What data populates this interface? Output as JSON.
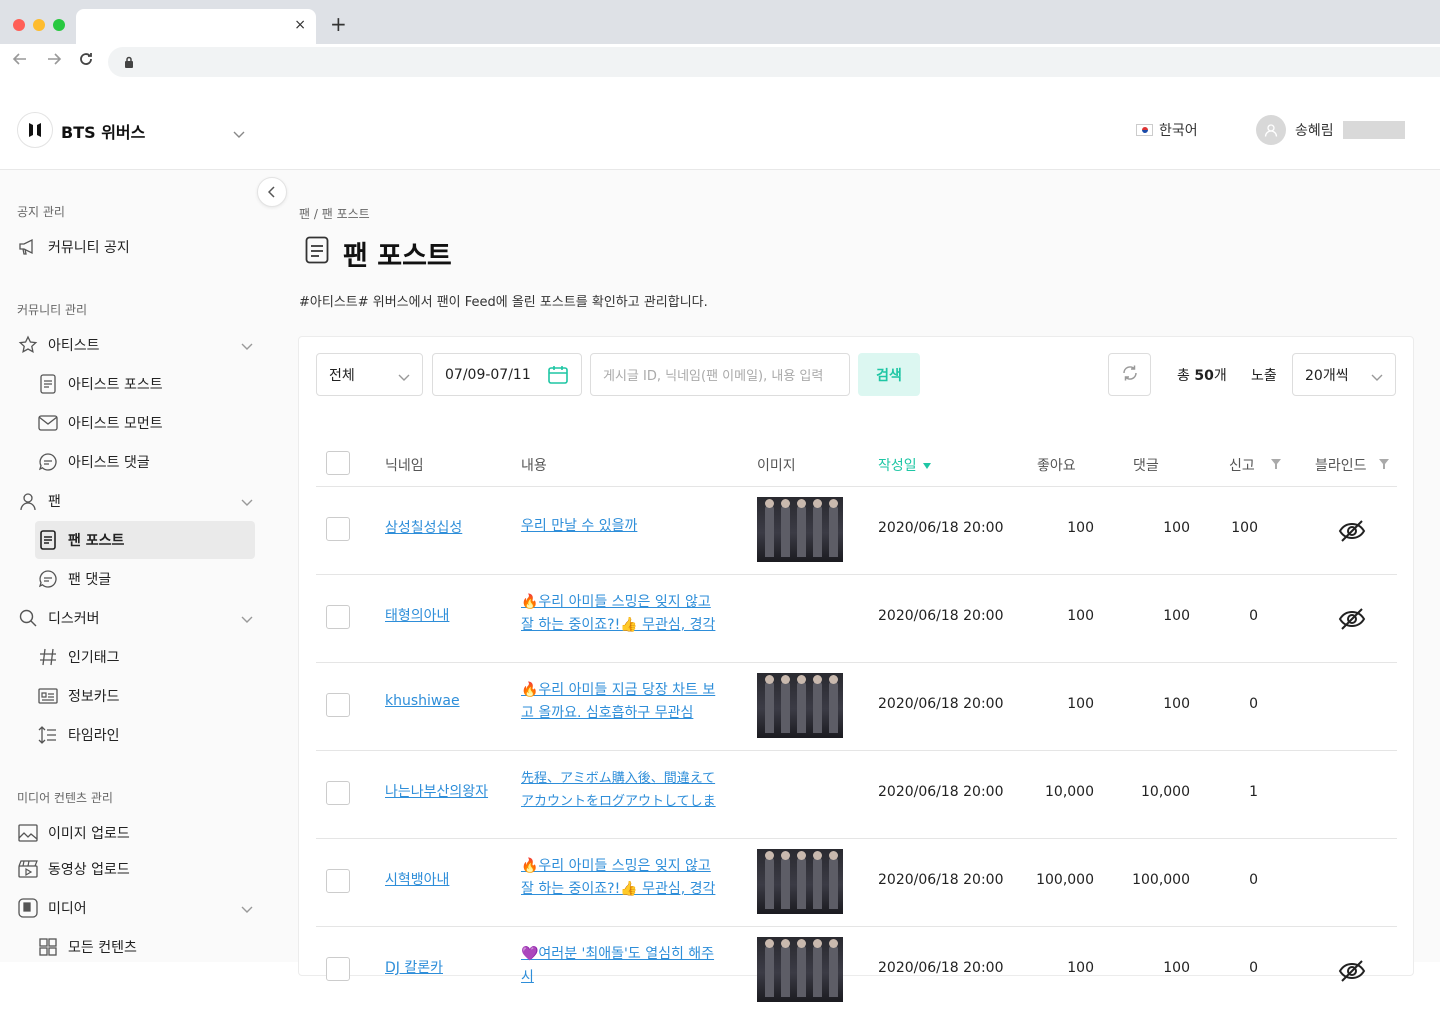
{
  "browser": {
    "new_tab_symbol": "+",
    "close_symbol": "×"
  },
  "app": {
    "name": "BTS 위버스",
    "language": "한국어",
    "user_name": "송혜림"
  },
  "sidebar": {
    "section1": "공지 관리",
    "notice": "커뮤니티 공지",
    "section2": "커뮤니티 관리",
    "artist": "아티스트",
    "artist_post": "아티스트 포스트",
    "artist_moment": "아티스트 모먼트",
    "artist_comment": "아티스트 댓글",
    "fan": "팬",
    "fan_post": "팬 포스트",
    "fan_comment": "팬 댓글",
    "discover": "디스커버",
    "popular_tag": "인기태그",
    "info_card": "정보카드",
    "timeline": "타임라인",
    "section3": "미디어 컨텐츠 관리",
    "image_upload": "이미지 업로드",
    "video_upload": "동영상 업로드",
    "media": "미디어",
    "all_content": "모든 컨텐츠"
  },
  "page": {
    "breadcrumb": "팬 / 팬 포스트",
    "title": "팬 포스트",
    "description": "#아티스트# 위버스에서 팬이 Feed에 올린 포스트를 확인하고 관리합니다."
  },
  "filters": {
    "category": "전체",
    "date_range": "07/09-07/11",
    "search_placeholder": "게시글 ID, 닉네임(팬 이메일), 내용 입력",
    "search_button": "검색",
    "total_prefix": "총",
    "total_count": "50",
    "total_suffix": "개",
    "exposure_label": "노출",
    "page_size": "20개씩"
  },
  "table": {
    "columns": {
      "nickname": "닉네임",
      "content": "내용",
      "image": "이미지",
      "date": "작성일",
      "likes": "좋아요",
      "comments": "댓글",
      "reports": "신고",
      "blind": "블라인드"
    },
    "rows": [
      {
        "nickname": "삼성칠성십성",
        "content": "우리 만날 수 있을까",
        "has_image": true,
        "date": "2020/06/18 20:00",
        "likes": "100",
        "comments": "100",
        "reports": "100",
        "blinded": true
      },
      {
        "nickname": "태형의아내",
        "content": "🔥우리 아미들 스밍은 잊지 않고 잘 하는 중이죠?!👍 무관심, 경각",
        "has_image": false,
        "date": "2020/06/18 20:00",
        "likes": "100",
        "comments": "100",
        "reports": "0",
        "blinded": true
      },
      {
        "nickname": "khushiwae",
        "content": "🔥우리 아미들 지금 당장 차트 보고 올까요. 심호흡하구 무관심",
        "has_image": true,
        "date": "2020/06/18 20:00",
        "likes": "100",
        "comments": "100",
        "reports": "0",
        "blinded": false
      },
      {
        "nickname": "나는나부산의왕자",
        "content": "先程、アミボム購入後、間違えてアカウントをログアウトしてしま",
        "has_image": false,
        "date": "2020/06/18 20:00",
        "likes": "10,000",
        "comments": "10,000",
        "reports": "1",
        "blinded": false
      },
      {
        "nickname": "시혁뱅아내",
        "content": "🔥우리 아미들 스밍은 잊지 않고 잘 하는 중이죠?!👍 무관심, 경각",
        "has_image": true,
        "date": "2020/06/18 20:00",
        "likes": "100,000",
        "comments": "100,000",
        "reports": "0",
        "blinded": false
      },
      {
        "nickname": "DJ 칼론카",
        "content": "💜여러분 '최애돌'도 열심히 해주시",
        "has_image": true,
        "date": "2020/06/18 20:00",
        "likes": "100",
        "comments": "100",
        "reports": "0",
        "blinded": true
      }
    ]
  },
  "colors": {
    "accent": "#1ec6a4",
    "link": "#2e8ed9",
    "active_bg": "#eaeaea"
  }
}
